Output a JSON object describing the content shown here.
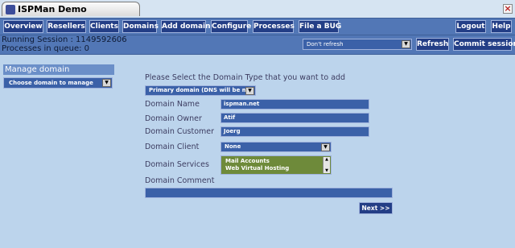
{
  "window": {
    "title": "ISPMan Demo"
  },
  "nav": {
    "items": [
      "Overview",
      "Resellers",
      "Clients",
      "Domains",
      "Add domain",
      "Configure",
      "Processes",
      "File a BUG"
    ],
    "logout": "Logout",
    "help": "Help"
  },
  "status": {
    "session": "Running Session : 1149592606",
    "queue": "Processes in queue: 0",
    "refresh_option": "Don't refresh",
    "refresh_label": "Refresh",
    "commit_label": "Commit session"
  },
  "sidebar": {
    "heading": "Manage domain",
    "select_value": "Choose domain to manage"
  },
  "form": {
    "prompt": "Please Select the Domain Type that you want to add",
    "domain_type": "Primary domain (DNS will be ma",
    "domain_name_label": "Domain Name",
    "domain_name": "ispman.net",
    "domain_owner_label": "Domain Owner",
    "domain_owner": "Atif",
    "domain_customer_label": "Domain Customer",
    "domain_customer": "Joerg",
    "domain_client_label": "Domain Client",
    "domain_client": "None",
    "domain_services_label": "Domain Services",
    "services": [
      "Mail Accounts",
      "Web Virtual Hosting"
    ],
    "domain_comment_label": "Domain Comment",
    "domain_comment": "",
    "next_label": "Next >>"
  },
  "colors": {
    "background": "#bcd4ec",
    "bar": "#5277b6",
    "button": "#233e86",
    "field": "#3b61a8",
    "services_bg": "#6e8a3a"
  }
}
